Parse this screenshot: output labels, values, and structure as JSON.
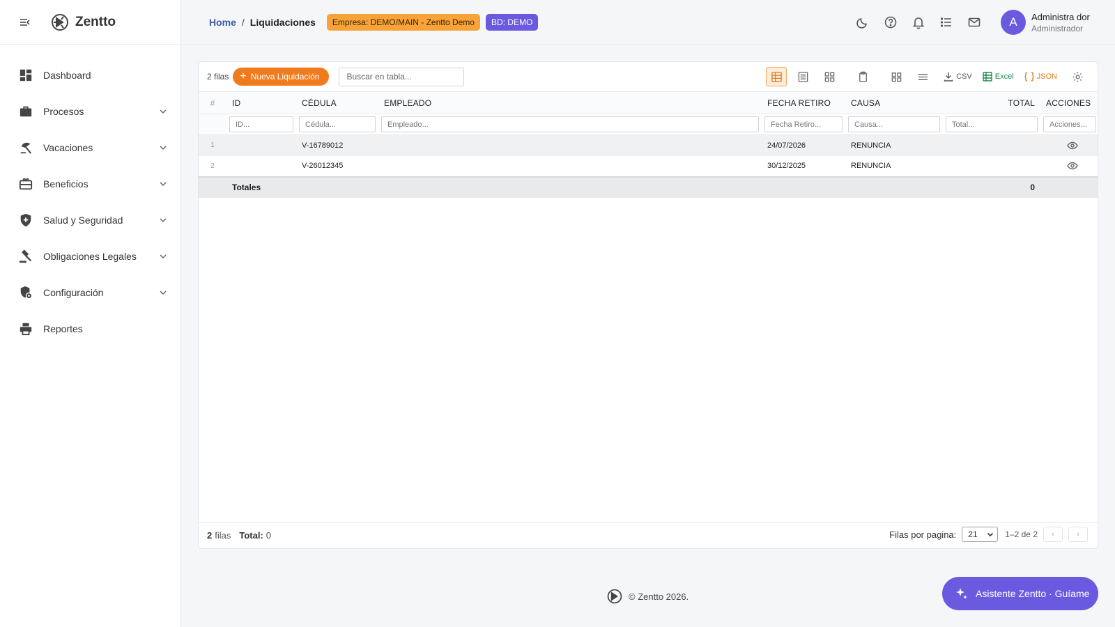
{
  "app": {
    "name": "Zentto"
  },
  "sidebar": {
    "items": [
      {
        "label": "Dashboard",
        "icon": "dashboard-icon",
        "expandable": false
      },
      {
        "label": "Procesos",
        "icon": "briefcase-icon",
        "expandable": true
      },
      {
        "label": "Vacaciones",
        "icon": "beach-icon",
        "expandable": true
      },
      {
        "label": "Beneficios",
        "icon": "gift-card-icon",
        "expandable": true
      },
      {
        "label": "Salud y Seguridad",
        "icon": "shield-plus-icon",
        "expandable": true
      },
      {
        "label": "Obligaciones Legales",
        "icon": "gavel-icon",
        "expandable": true
      },
      {
        "label": "Configuración",
        "icon": "settings-shield-icon",
        "expandable": true
      },
      {
        "label": "Reportes",
        "icon": "printer-icon",
        "expandable": false
      }
    ]
  },
  "header": {
    "breadcrumb": {
      "home": "Home",
      "separator": "/",
      "current": "Liquidaciones"
    },
    "company_badge": "Empresa: DEMO/MAIN - Zentto Demo",
    "db_badge": "BD: DEMO",
    "user": {
      "initial": "A",
      "name": "Administra dor",
      "role": "Administrador"
    }
  },
  "toolbar": {
    "rows_label": "2 filas",
    "new_button": "Nueva Liquidación",
    "search_placeholder": "Buscar en tabla...",
    "exports": {
      "csv": "CSV",
      "excel": "Excel",
      "json": "JSON"
    }
  },
  "table": {
    "columns": {
      "num": "#",
      "id": "ID",
      "cedula": "CÉDULA",
      "empleado": "EMPLEADO",
      "fecha": "FECHA RETIRO",
      "causa": "CAUSA",
      "total": "TOTAL",
      "acciones": "ACCIONES"
    },
    "filters": {
      "id": "ID...",
      "cedula": "Cédula...",
      "empleado": "Empleado...",
      "fecha": "Fecha Retiro...",
      "causa": "Causa...",
      "total": "Total...",
      "acciones": "Acciones..."
    },
    "rows": [
      {
        "num": "1",
        "id": "",
        "cedula": "V-16789012",
        "empleado": "",
        "fecha": "24/07/2026",
        "causa": "RENUNCIA",
        "total": ""
      },
      {
        "num": "2",
        "id": "",
        "cedula": "V-26012345",
        "empleado": "",
        "fecha": "30/12/2025",
        "causa": "RENUNCIA",
        "total": ""
      }
    ],
    "totals": {
      "label": "Totales",
      "total": "0"
    }
  },
  "footer_bar": {
    "rows_count": "2",
    "rows_word": "filas",
    "total_label": "Total:",
    "total_value": "0",
    "per_page_label": "Filas por pagina:",
    "per_page_value": "21",
    "range": "1–2 de 2",
    "prev": "‹",
    "next": "›"
  },
  "page_footer": {
    "text": "© Zentto 2026."
  },
  "assistant": {
    "label": "Asistente Zentto · Guíame"
  },
  "colors": {
    "accent": "#f07b1d",
    "purple": "#6a5ae0",
    "badge_orange": "#f7a33a",
    "link": "#3b5ba5"
  }
}
